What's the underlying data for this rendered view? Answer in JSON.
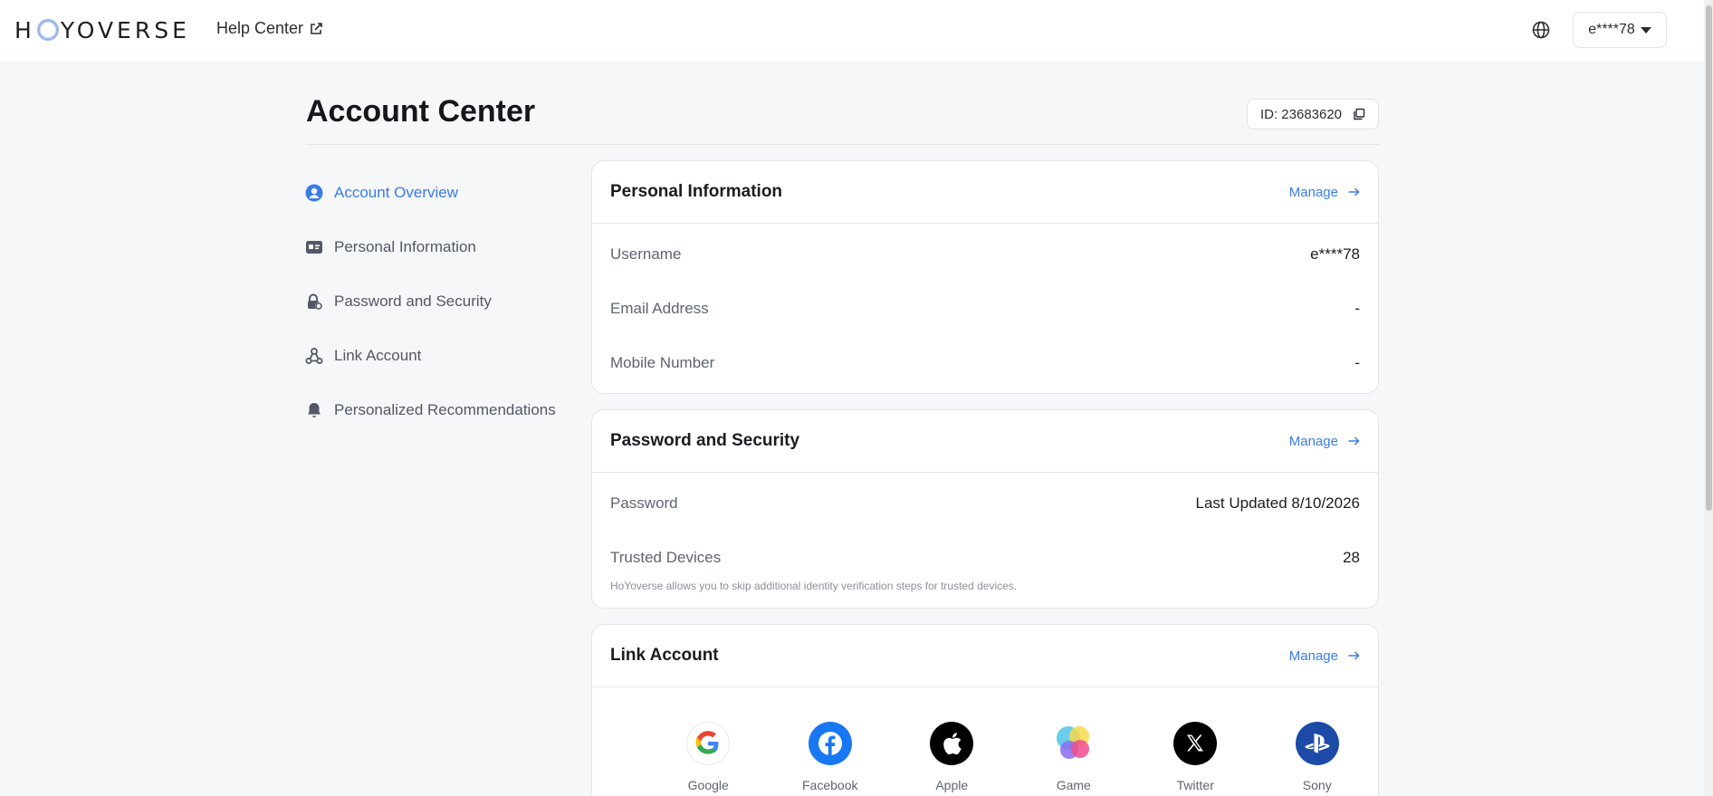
{
  "topbar": {
    "logo_text": "HOYOVERSE",
    "help_label": "Help Center",
    "user_label": "e****78"
  },
  "header": {
    "title": "Account Center",
    "id_label": "ID: 23683620"
  },
  "sidebar": {
    "items": [
      {
        "label": "Account Overview",
        "icon": "user-circle-icon",
        "active": true
      },
      {
        "label": "Personal Information",
        "icon": "id-card-icon",
        "active": false
      },
      {
        "label": "Password and Security",
        "icon": "lock-shield-icon",
        "active": false
      },
      {
        "label": "Link Account",
        "icon": "link-nodes-icon",
        "active": false
      },
      {
        "label": "Personalized Recommendations",
        "icon": "bell-icon",
        "active": false
      }
    ]
  },
  "personal": {
    "title": "Personal Information",
    "manage": "Manage",
    "rows": [
      {
        "label": "Username",
        "value": "e****78"
      },
      {
        "label": "Email Address",
        "value": "-"
      },
      {
        "label": "Mobile Number",
        "value": "-"
      }
    ]
  },
  "security": {
    "title": "Password and Security",
    "manage": "Manage",
    "rows": [
      {
        "label": "Password",
        "value": "Last Updated 8/10/2026"
      },
      {
        "label": "Trusted Devices",
        "value": "28"
      }
    ],
    "note": "HoYoverse allows you to skip additional identity verification steps for trusted devices."
  },
  "link": {
    "title": "Link Account",
    "manage": "Manage",
    "accounts": [
      {
        "name": "Google",
        "icon": "google-icon"
      },
      {
        "name": "Facebook",
        "icon": "facebook-icon",
        "color": "#1877f2"
      },
      {
        "name": "Apple",
        "icon": "apple-icon",
        "color": "#000000"
      },
      {
        "name": "Game",
        "icon": "game-center-icon"
      },
      {
        "name": "Twitter",
        "icon": "x-twitter-icon",
        "color": "#000000"
      },
      {
        "name": "Sony",
        "icon": "playstation-icon",
        "color": "#1c4aa6"
      }
    ]
  },
  "colors": {
    "accent": "#3a7ce8",
    "background": "#f6f7f9"
  }
}
